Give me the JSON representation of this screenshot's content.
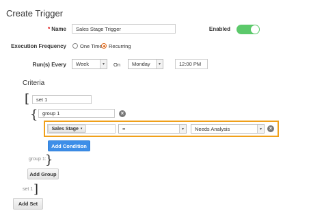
{
  "page": {
    "title": "Create Trigger"
  },
  "form": {
    "name_label": "Name",
    "name_value": "Sales Stage Trigger",
    "enabled_label": "Enabled",
    "enabled_on": true,
    "execution_frequency_label": "Execution Frequency",
    "frequency_options": [
      "One Time",
      "Recurring"
    ],
    "frequency_selected": "Recurring",
    "runs_every_label": "Run(s) Every",
    "runs_every_value": "Week",
    "on_label": "On",
    "day_value": "Monday",
    "time_value": "12:00 PM"
  },
  "criteria": {
    "heading": "Criteria",
    "set_name": "set 1",
    "group_name": "group 1",
    "condition": {
      "field": "Sales Stage",
      "operator": "=",
      "value": "Needs Analysis"
    },
    "add_condition_label": "Add Condition",
    "group_footer": "group 1:",
    "add_group_label": "Add Group",
    "set_footer": "set 1",
    "add_set_label": "Add Set"
  },
  "colors": {
    "toggle": "#5cc96b",
    "highlight": "#f0a019",
    "primary_button": "#3d8ee8",
    "radio_selected": "#e06a1c"
  }
}
